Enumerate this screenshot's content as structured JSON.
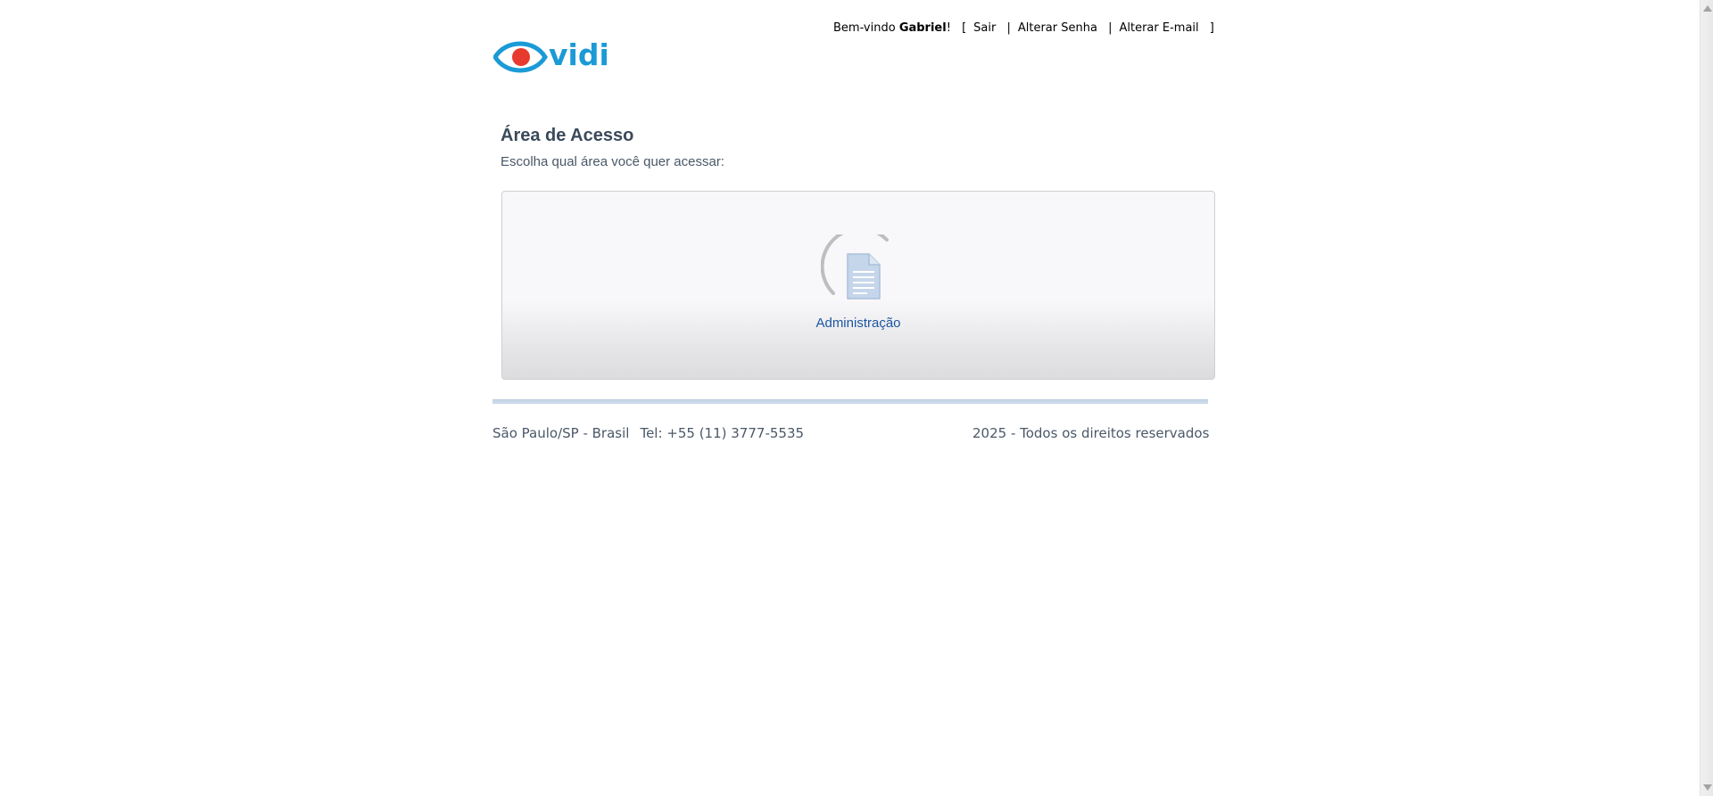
{
  "header": {
    "logo_text": "vidi",
    "welcome_prefix": "Bem-vindo ",
    "user_name": "Gabriel",
    "welcome_suffix": "!",
    "bracket_open": "[",
    "bracket_close": "]",
    "separator": "|",
    "links": {
      "logout": "Sair",
      "change_password": "Alterar Senha",
      "change_email": "Alterar E-mail"
    }
  },
  "main": {
    "title": "Área de Acesso",
    "subtitle": "Escolha qual área você quer acessar:",
    "areas": [
      {
        "label": "Administração",
        "icon": "document-icon"
      }
    ]
  },
  "footer": {
    "location": "São Paulo/SP - Brasil",
    "phone": "Tel: +55 (11) 3777-5535",
    "copyright": "2025 - Todos os direitos reservados"
  },
  "colors": {
    "brand_blue": "#1a9ad6",
    "brand_red": "#e63b2e",
    "heading": "#3b4a5a",
    "link_blue": "#1c56a2"
  }
}
